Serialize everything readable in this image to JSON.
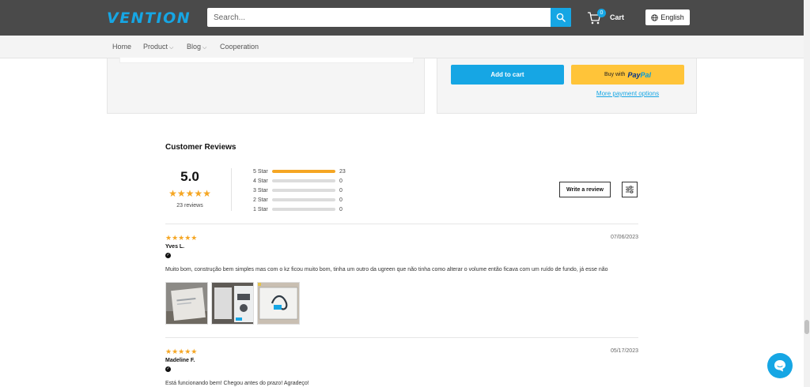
{
  "header": {
    "logo_text": "VENTION",
    "search_placeholder": "Search...",
    "cart_count": "0",
    "cart_label": "Cart",
    "language": "English",
    "colors": {
      "brand": "#16a6e4",
      "header_bg": "#4a4a4a"
    }
  },
  "nav": {
    "items": [
      {
        "label": "Home",
        "dropdown": false
      },
      {
        "label": "Product",
        "dropdown": true
      },
      {
        "label": "Blog",
        "dropdown": true
      },
      {
        "label": "Cooperation",
        "dropdown": false
      }
    ]
  },
  "product": {
    "add_to_cart": "Add to cart",
    "paypal_prefix": "Buy with",
    "paypal_logo_a": "Pay",
    "paypal_logo_b": "Pal",
    "more_payment": "More payment options"
  },
  "reviews": {
    "title": "Customer Reviews",
    "average": "5.0",
    "average_stars": "★★★★★",
    "total": "23 reviews",
    "breakdown": [
      {
        "label": "5 Star",
        "count": "23",
        "fraction": 1.0
      },
      {
        "label": "4 Star",
        "count": "0",
        "fraction": 0
      },
      {
        "label": "3 Star",
        "count": "0",
        "fraction": 0
      },
      {
        "label": "2 Star",
        "count": "0",
        "fraction": 0
      },
      {
        "label": "1 Star",
        "count": "0",
        "fraction": 0
      }
    ],
    "write_review": "Write a review",
    "items": [
      {
        "stars": "★★★★★",
        "date": "07/06/2023",
        "author": "Yves L.",
        "text": "Muito bom, construção bem simples mas com o kz ficou muito bom, tinha um outro da ugreen que não tinha como alterar o volume então ficava com um ruído de fundo, já esse não"
      },
      {
        "stars": "★★★★★",
        "date": "05/17/2023",
        "author": "Madeline F.",
        "text": "Está funcionando bem! Chegou antes do prazo! Agradeço!"
      }
    ]
  }
}
